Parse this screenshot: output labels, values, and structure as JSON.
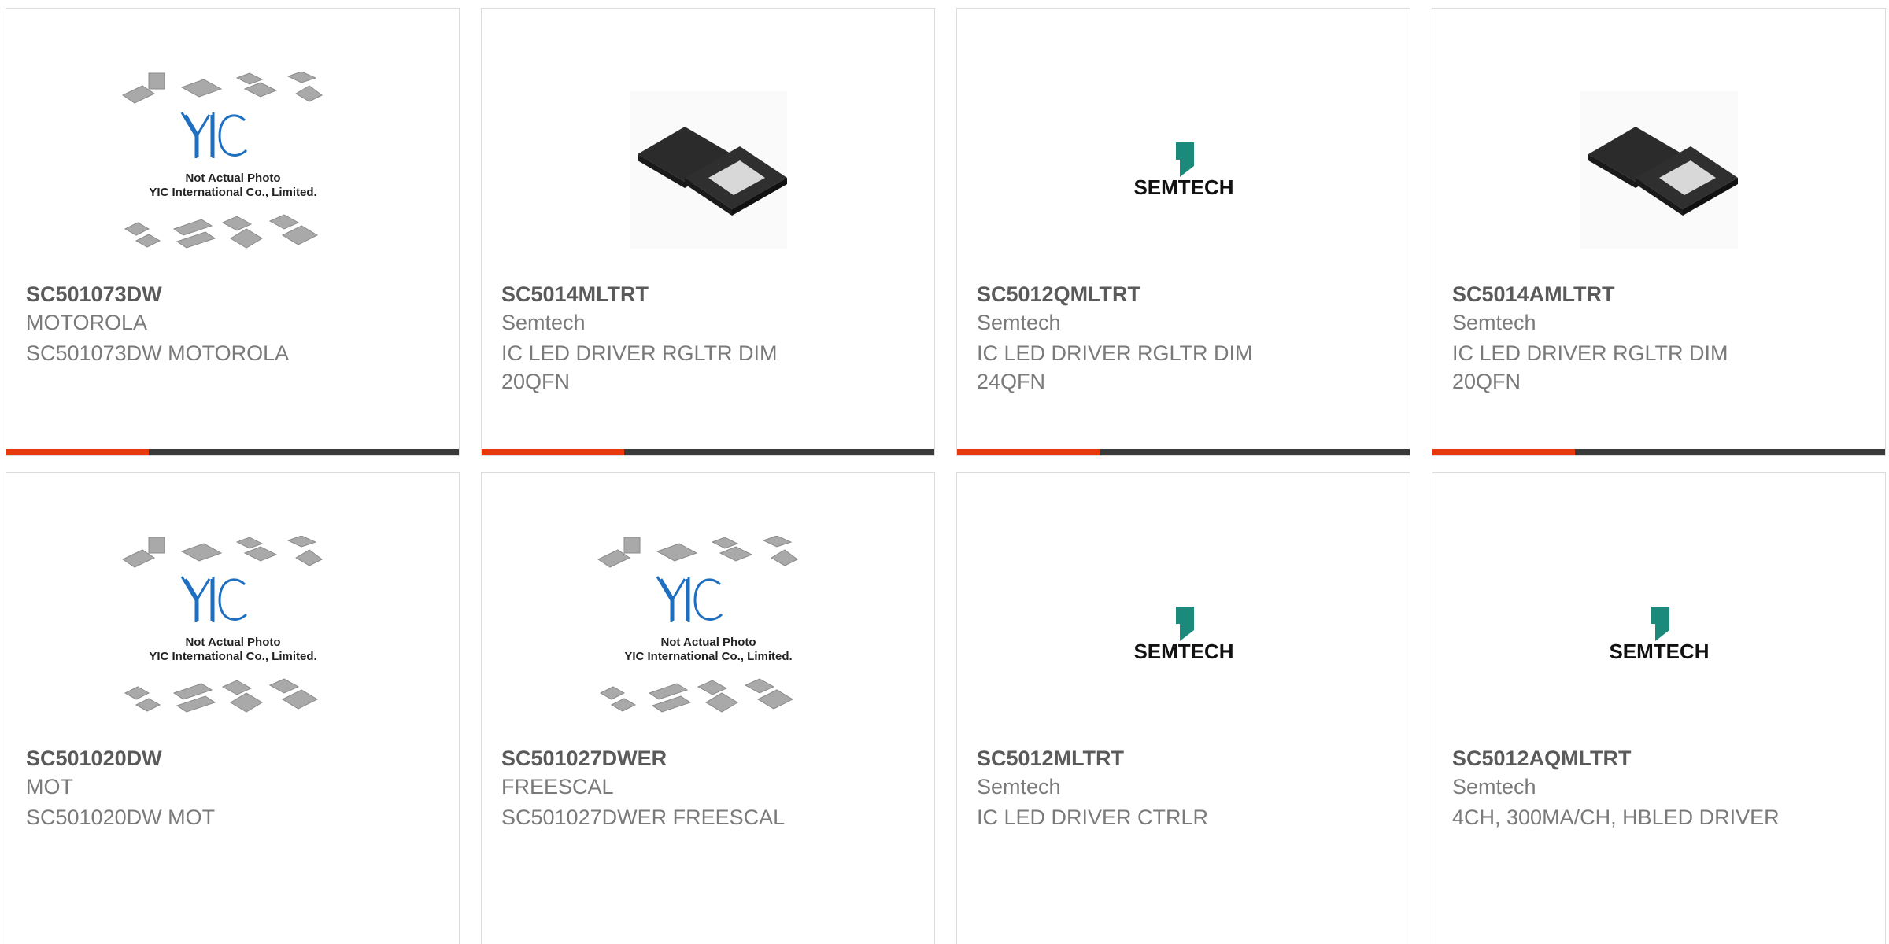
{
  "products": [
    {
      "part": "SC501073DW",
      "manufacturer": "MOTOROLA",
      "description": "SC501073DW MOTOROLA",
      "image": "yic-placeholder",
      "placeholder_lines": [
        "Not Actual Photo",
        "YIC International Co., Limited."
      ],
      "logo_text": "YIC"
    },
    {
      "part": "SC5014MLTRT",
      "manufacturer": "Semtech",
      "description": "IC LED DRIVER RGLTR DIM 20QFN",
      "image": "qfn-chip-photo"
    },
    {
      "part": "SC5012QMLTRT",
      "manufacturer": "Semtech",
      "description": "IC LED DRIVER RGLTR DIM 24QFN",
      "image": "semtech-logo",
      "logo_text": "SEMTECH"
    },
    {
      "part": "SC5014AMLTRT",
      "manufacturer": "Semtech",
      "description": "IC LED DRIVER RGLTR DIM 20QFN",
      "image": "qfn-chip-photo"
    },
    {
      "part": "SC501020DW",
      "manufacturer": "MOT",
      "description": "SC501020DW MOT",
      "image": "yic-placeholder",
      "placeholder_lines": [
        "Not Actual Photo",
        "YIC International Co., Limited."
      ],
      "logo_text": "YIC"
    },
    {
      "part": "SC501027DWER",
      "manufacturer": "FREESCAL",
      "description": "SC501027DWER FREESCAL",
      "image": "yic-placeholder",
      "placeholder_lines": [
        "Not Actual Photo",
        "YIC International Co., Limited."
      ],
      "logo_text": "YIC"
    },
    {
      "part": "SC5012MLTRT",
      "manufacturer": "Semtech",
      "description": "IC LED DRIVER CTRLR",
      "image": "semtech-logo",
      "logo_text": "SEMTECH"
    },
    {
      "part": "SC5012AQMLTRT",
      "manufacturer": "Semtech",
      "description": "4CH, 300MA/CH, HBLED DRIVER",
      "image": "semtech-logo",
      "logo_text": "SEMTECH"
    }
  ],
  "colors": {
    "accent": "#e8380d",
    "bar": "#3a3a3a",
    "yic_blue": "#1e6fc0",
    "semtech_teal": "#1b8a7a",
    "chip": "#2b2b2b"
  }
}
